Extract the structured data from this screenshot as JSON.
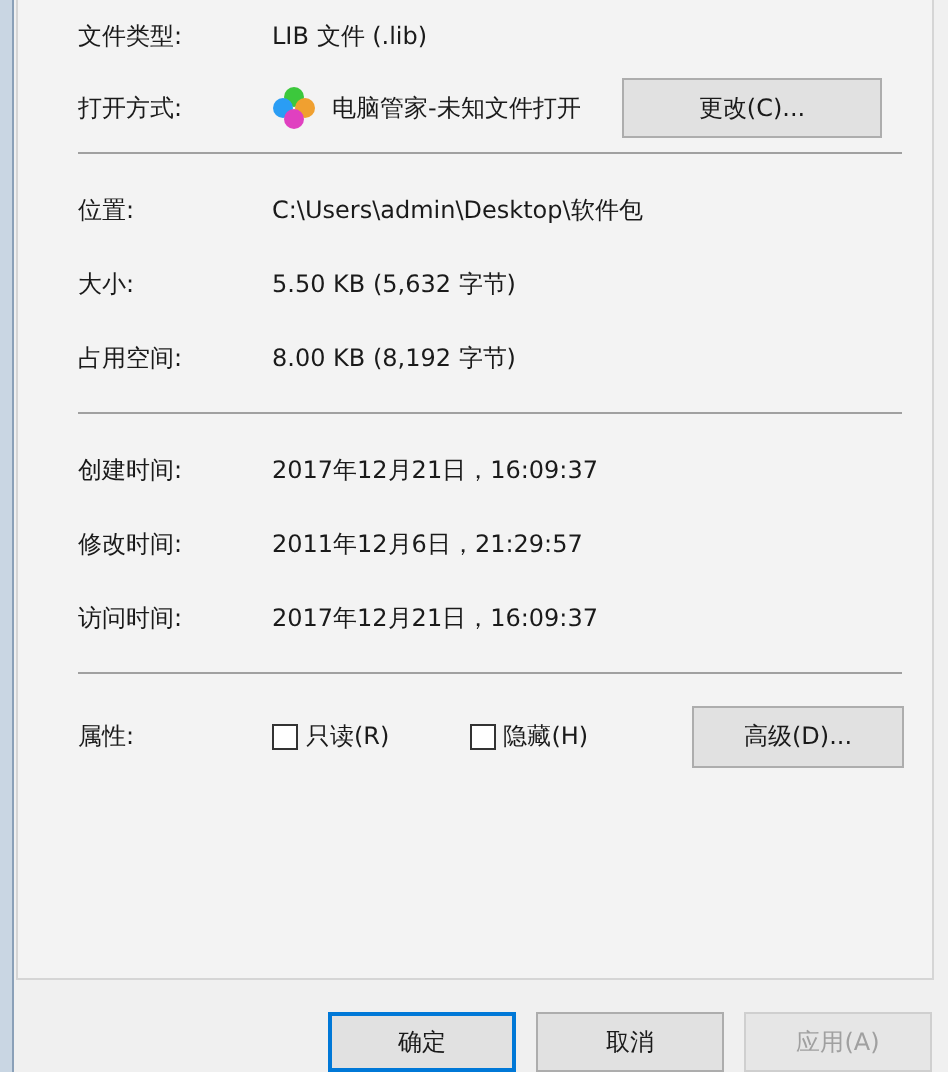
{
  "info_groups": [
    {
      "rows": [
        {
          "label": "文件类型:",
          "value": "LIB 文件 (.lib)"
        },
        {
          "label": "打开方式:",
          "value": "电脑管家-未知文件打开",
          "kind": "app",
          "button": "更改(C)..."
        }
      ]
    },
    {
      "rows": [
        {
          "label": "位置:",
          "value": "C:\\Users\\admin\\Desktop\\软件包"
        },
        {
          "label": "大小:",
          "value": "5.50 KB (5,632 字节)"
        },
        {
          "label": "占用空间:",
          "value": "8.00 KB (8,192 字节)"
        }
      ]
    },
    {
      "rows": [
        {
          "label": "创建时间:",
          "value": "2017年12月21日，16:09:37"
        },
        {
          "label": "修改时间:",
          "value": "2011年12月6日，21:29:57"
        },
        {
          "label": "访问时间:",
          "value": "2017年12月21日，16:09:37"
        }
      ]
    }
  ],
  "attributes": {
    "label": "属性:",
    "checkboxes": [
      {
        "label": "只读(R)",
        "checked": false
      },
      {
        "label": "隐藏(H)",
        "checked": false
      }
    ],
    "button": "高级(D)..."
  },
  "dialog_buttons": [
    {
      "label": "确定",
      "focused": true,
      "disabled": false
    },
    {
      "label": "取消",
      "focused": false,
      "disabled": false
    },
    {
      "label": "应用(A)",
      "focused": false,
      "disabled": true
    }
  ]
}
